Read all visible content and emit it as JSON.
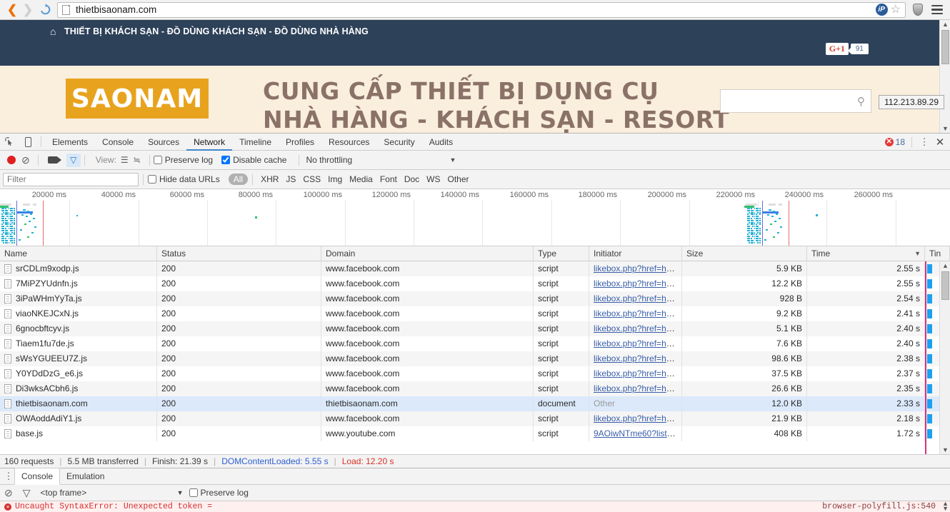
{
  "browser": {
    "url": "thietbisaonam.com",
    "back_icon": "back-arrow-icon",
    "forward_icon": "forward-arrow-icon",
    "reload_icon": "reload-icon",
    "ip_badge": "iP",
    "star_icon": "★",
    "menu_icon": "hamburger-menu-icon"
  },
  "webpage": {
    "topbar_title": "THIẾT BỊ KHÁCH SẠN - ĐỒ DÙNG KHÁCH SẠN - ĐỒ DÙNG NHÀ HÀNG",
    "home_icon": "⌂",
    "gplus_label": "G+1",
    "gplus_count": "91",
    "logo_text": "SAONAM",
    "slogan_line1": "CUNG CẤP THIẾT BỊ DỤNG CỤ",
    "slogan_line2": "NHÀ HÀNG - KHÁCH SẠN - RESORT",
    "search_icon": "⚲",
    "ip_tooltip": "112.213.89.29"
  },
  "devtools": {
    "tabs": [
      {
        "label": "Elements",
        "active": false
      },
      {
        "label": "Console",
        "active": false
      },
      {
        "label": "Sources",
        "active": false
      },
      {
        "label": "Network",
        "active": true
      },
      {
        "label": "Timeline",
        "active": false
      },
      {
        "label": "Profiles",
        "active": false
      },
      {
        "label": "Resources",
        "active": false
      },
      {
        "label": "Security",
        "active": false
      },
      {
        "label": "Audits",
        "active": false
      }
    ],
    "inspect_icon": "inspect-element-icon",
    "device_icon": "device-toolbar-icon",
    "error_count": "18",
    "error_glyph": "✕",
    "more_icon": "⋮",
    "close_icon": "✕",
    "controls": {
      "record_icon": "record-button",
      "clear_icon": "⊘",
      "capture_icon": "camera-icon",
      "filter_icon": "▽",
      "view_label": "View:",
      "view_list_icon": "☰",
      "view_waterfall_icon": "≒",
      "preserve_log": "Preserve log",
      "preserve_log_checked": false,
      "disable_cache": "Disable cache",
      "disable_cache_checked": true,
      "throttling": "No throttling",
      "caret": "▼"
    },
    "filters": {
      "placeholder": "Filter",
      "value": "",
      "hide_data_urls": "Hide data URLs",
      "hide_data_urls_checked": false,
      "types": [
        "All",
        "XHR",
        "JS",
        "CSS",
        "Img",
        "Media",
        "Font",
        "Doc",
        "WS",
        "Other"
      ],
      "selected_type": "All"
    },
    "overview": {
      "ticks": [
        "20000 ms",
        "40000 ms",
        "60000 ms",
        "80000 ms",
        "100000 ms",
        "120000 ms",
        "140000 ms",
        "160000 ms",
        "180000 ms",
        "200000 ms",
        "220000 ms",
        "240000 ms",
        "260000 ms"
      ]
    },
    "columns": [
      "Name",
      "Status",
      "Domain",
      "Type",
      "Initiator",
      "Size",
      "Time",
      "Tin"
    ],
    "sort_column": "Time",
    "sort_caret": "▼",
    "rows": [
      {
        "name": "srCDLm9xodp.js",
        "status": "200",
        "domain": "www.facebook.com",
        "type": "script",
        "initiator": "likebox.php?href=http…",
        "size": "5.9 KB",
        "time": "2.55 s"
      },
      {
        "name": "7MiPZYUdnfn.js",
        "status": "200",
        "domain": "www.facebook.com",
        "type": "script",
        "initiator": "likebox.php?href=http…",
        "size": "12.2 KB",
        "time": "2.55 s"
      },
      {
        "name": "3iPaWHmYyTa.js",
        "status": "200",
        "domain": "www.facebook.com",
        "type": "script",
        "initiator": "likebox.php?href=http…",
        "size": "928 B",
        "time": "2.54 s"
      },
      {
        "name": "viaoNKEJCxN.js",
        "status": "200",
        "domain": "www.facebook.com",
        "type": "script",
        "initiator": "likebox.php?href=http…",
        "size": "9.2 KB",
        "time": "2.41 s"
      },
      {
        "name": "6gnocbftcyv.js",
        "status": "200",
        "domain": "www.facebook.com",
        "type": "script",
        "initiator": "likebox.php?href=http…",
        "size": "5.1 KB",
        "time": "2.40 s"
      },
      {
        "name": "Tiaem1fu7de.js",
        "status": "200",
        "domain": "www.facebook.com",
        "type": "script",
        "initiator": "likebox.php?href=http…",
        "size": "7.6 KB",
        "time": "2.40 s"
      },
      {
        "name": "sWsYGUEEU7Z.js",
        "status": "200",
        "domain": "www.facebook.com",
        "type": "script",
        "initiator": "likebox.php?href=http…",
        "size": "98.6 KB",
        "time": "2.38 s"
      },
      {
        "name": "Y0YDdDzG_e6.js",
        "status": "200",
        "domain": "www.facebook.com",
        "type": "script",
        "initiator": "likebox.php?href=http…",
        "size": "37.5 KB",
        "time": "2.37 s"
      },
      {
        "name": "Di3wksACbh6.js",
        "status": "200",
        "domain": "www.facebook.com",
        "type": "script",
        "initiator": "likebox.php?href=http…",
        "size": "26.6 KB",
        "time": "2.35 s"
      },
      {
        "name": "thietbisaonam.com",
        "status": "200",
        "domain": "thietbisaonam.com",
        "type": "document",
        "initiator": "Other",
        "size": "12.0 KB",
        "time": "2.33 s",
        "selected": true,
        "initiator_plain": true
      },
      {
        "name": "OWAoddAdiY1.js",
        "status": "200",
        "domain": "www.facebook.com",
        "type": "script",
        "initiator": "likebox.php?href=http…",
        "size": "21.9 KB",
        "time": "2.18 s"
      },
      {
        "name": "base.js",
        "status": "200",
        "domain": "www.youtube.com",
        "type": "script",
        "initiator": "9AOiwNTme60?list=P…",
        "size": "408 KB",
        "time": "1.72 s"
      }
    ],
    "summary": {
      "requests": "160 requests",
      "transferred": "5.5 MB transferred",
      "finish": "Finish: 21.39 s",
      "dom_content_loaded": "DOMContentLoaded: 5.55 s",
      "load": "Load: 12.20 s",
      "separator": "|"
    },
    "drawer": {
      "handle_icon": "⋮",
      "tabs": [
        {
          "label": "Console",
          "active": true
        },
        {
          "label": "Emulation",
          "active": false
        }
      ],
      "clear_icon": "⊘",
      "filter_icon": "▽",
      "frame": "<top frame>",
      "caret": "▼",
      "preserve_log": "Preserve log",
      "preserve_log_checked": false,
      "error_message": "Uncaught SyntaxError: Unexpected token =",
      "error_source": "browser-polyfill.js:540",
      "error_glyph": "✕"
    }
  },
  "colors": {
    "accent_blue": "#4285cc",
    "waterfall_bar": "#1ba1f2",
    "red_line": "#d9327c",
    "error_red": "#d32f2f",
    "dcl_blue": "#2b5fd0",
    "load_red": "#d93025",
    "site_navy": "#2d4159",
    "logo_gold": "#e8a31e"
  }
}
